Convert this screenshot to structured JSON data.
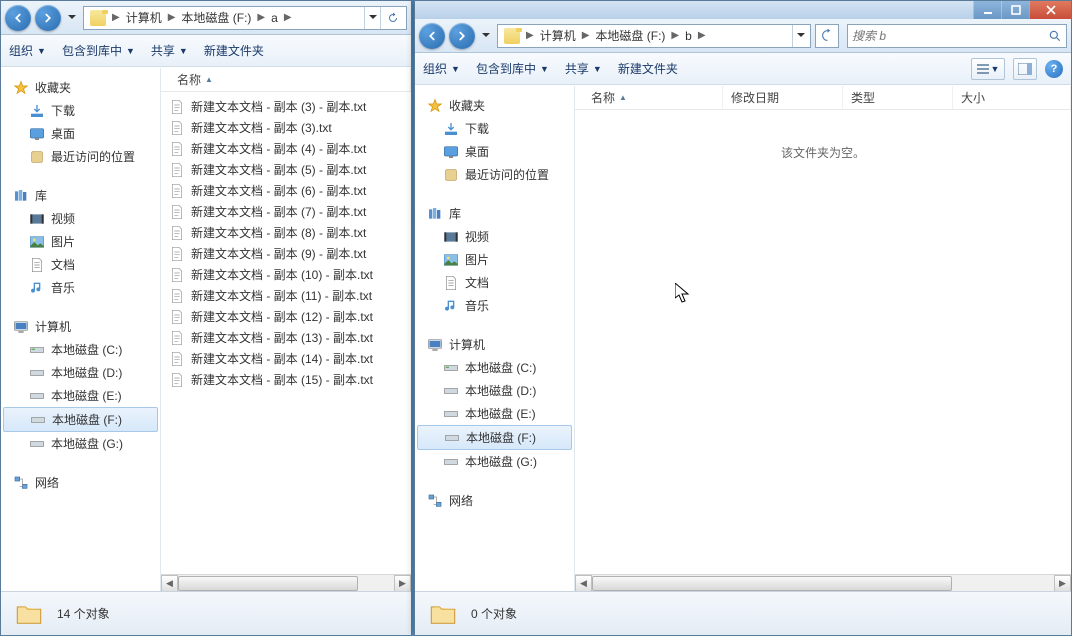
{
  "left": {
    "breadcrumb": {
      "computer": "计算机",
      "disk": "本地磁盘 (F:)",
      "folder": "a"
    },
    "toolbar": {
      "organize": "组织",
      "include": "包含到库中",
      "share": "共享",
      "new_folder": "新建文件夹"
    },
    "columns": {
      "name": "名称"
    },
    "files": [
      "新建文本文档 - 副本 (3) - 副本.txt",
      "新建文本文档 - 副本 (3).txt",
      "新建文本文档 - 副本 (4) - 副本.txt",
      "新建文本文档 - 副本 (5) - 副本.txt",
      "新建文本文档 - 副本 (6) - 副本.txt",
      "新建文本文档 - 副本 (7) - 副本.txt",
      "新建文本文档 - 副本 (8) - 副本.txt",
      "新建文本文档 - 副本 (9) - 副本.txt",
      "新建文本文档 - 副本 (10) - 副本.txt",
      "新建文本文档 - 副本 (11) - 副本.txt",
      "新建文本文档 - 副本 (12) - 副本.txt",
      "新建文本文档 - 副本 (13) - 副本.txt",
      "新建文本文档 - 副本 (14) - 副本.txt",
      "新建文本文档 - 副本 (15) - 副本.txt"
    ],
    "status": "14 个对象"
  },
  "right": {
    "breadcrumb": {
      "computer": "计算机",
      "disk": "本地磁盘 (F:)",
      "folder": "b"
    },
    "search_placeholder": "搜索 b",
    "toolbar": {
      "organize": "组织",
      "include": "包含到库中",
      "share": "共享",
      "new_folder": "新建文件夹"
    },
    "columns": {
      "name": "名称",
      "date": "修改日期",
      "type": "类型",
      "size": "大小"
    },
    "empty": "该文件夹为空。",
    "status": "0 个对象"
  },
  "nav": {
    "favorites": "收藏夹",
    "downloads": "下载",
    "desktop": "桌面",
    "recent": "最近访问的位置",
    "libraries": "库",
    "videos": "视频",
    "pictures": "图片",
    "documents": "文档",
    "music": "音乐",
    "computer": "计算机",
    "disk_c": "本地磁盘 (C:)",
    "disk_d": "本地磁盘 (D:)",
    "disk_e": "本地磁盘 (E:)",
    "disk_f": "本地磁盘 (F:)",
    "disk_g": "本地磁盘 (G:)",
    "network": "网络"
  }
}
